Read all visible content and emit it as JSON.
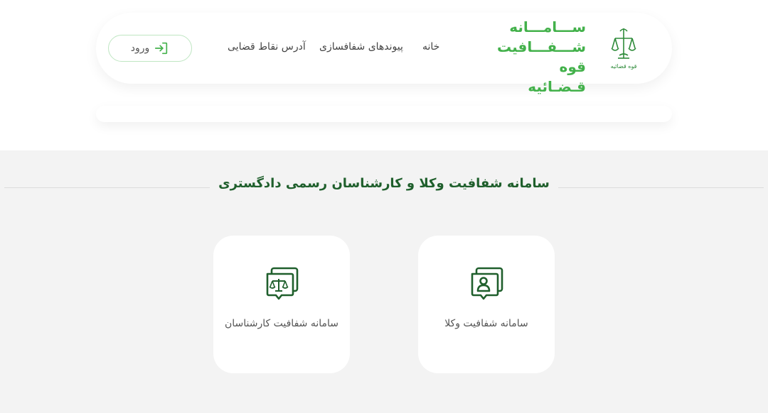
{
  "header": {
    "logo": {
      "line1": "ســـامـــانه",
      "line2": "شـــفـــافیت",
      "line3": "قوه قـضـائیه",
      "emblem_caption": "قوه قضائیه"
    },
    "nav": {
      "home": "خانه",
      "transparency_links": "پیوندهای شفافسازی",
      "judicial_addresses": "آدرس نقاط قضایی"
    },
    "login_label": "ورود"
  },
  "main": {
    "title": "سامانه شفافیت وکلا و کارشناسان رسمی دادگستری",
    "cards": [
      {
        "label": "سامانه شفافیت وکلا",
        "icon": "lawyer-profile-icon"
      },
      {
        "label": "سامانه شفافیت کارشناسان",
        "icon": "scales-of-justice-icon"
      }
    ]
  },
  "colors": {
    "brand_green": "#43b14b",
    "dark_green": "#1f5f2c",
    "background_gray": "#f3f3f3"
  }
}
